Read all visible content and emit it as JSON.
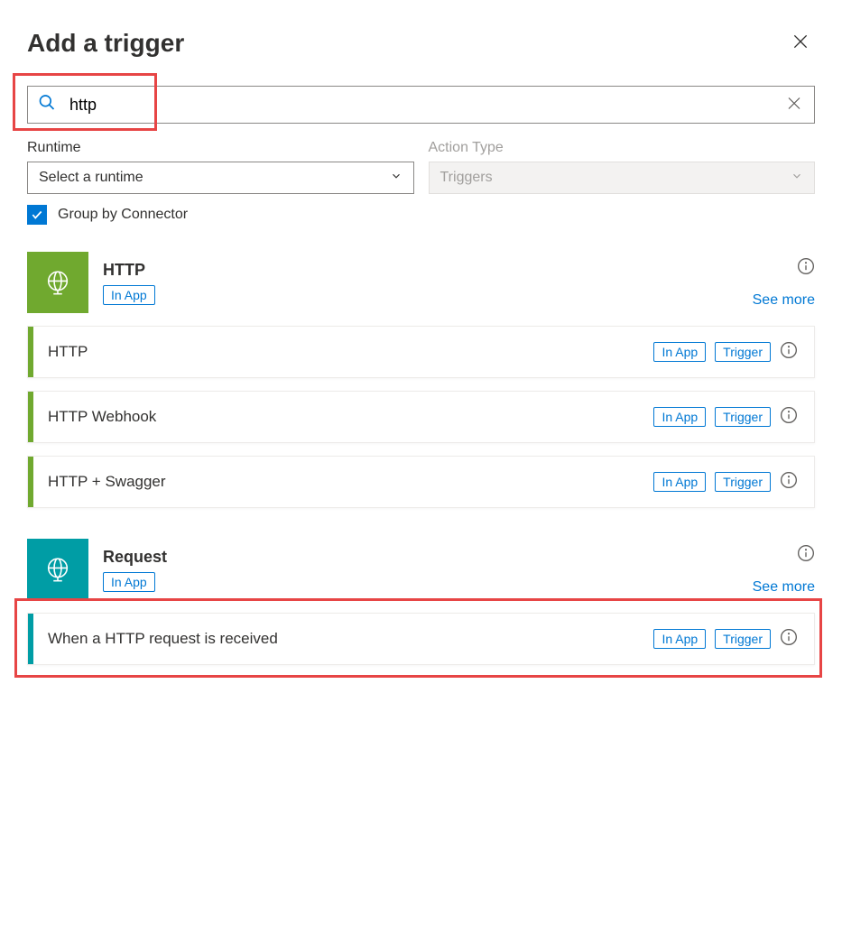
{
  "header": {
    "title": "Add a trigger"
  },
  "search": {
    "value": "http"
  },
  "filters": {
    "runtime": {
      "label": "Runtime",
      "placeholder": "Select a runtime"
    },
    "actionType": {
      "label": "Action Type",
      "value": "Triggers"
    }
  },
  "groupBy": {
    "label": "Group by Connector",
    "checked": true
  },
  "badges": {
    "inApp": "In App",
    "trigger": "Trigger"
  },
  "links": {
    "seeMore": "See more"
  },
  "connectors": [
    {
      "name": "HTTP",
      "color": "green",
      "triggers": [
        {
          "name": "HTTP"
        },
        {
          "name": "HTTP Webhook"
        },
        {
          "name": "HTTP + Swagger"
        }
      ]
    },
    {
      "name": "Request",
      "color": "teal",
      "triggers": [
        {
          "name": "When a HTTP request is received"
        }
      ]
    }
  ]
}
